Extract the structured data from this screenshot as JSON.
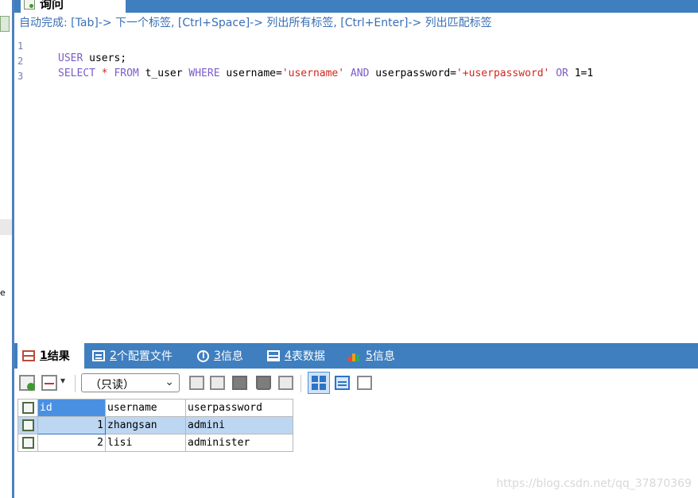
{
  "left_panel": {
    "partial_char": "e"
  },
  "query_tab": {
    "label": "询问",
    "add_label": "+"
  },
  "editor": {
    "hint": "自动完成: [Tab]-> 下一个标签, [Ctrl+Space]-> 列出所有标签, [Ctrl+Enter]-> 列出匹配标签",
    "lines": [
      {
        "no": "1",
        "kw1": "USER",
        "rest": " users;"
      },
      {
        "no": "2",
        "kw1": "SELECT",
        "star": " * ",
        "kw2": "FROM",
        "t1": " t_user ",
        "kw3": "WHERE",
        "t2": " username=",
        "s1": "'username'",
        "t3": " ",
        "kw4": "AND",
        "t4": " userpassword=",
        "s2": "'+userpassword'",
        "t5": " ",
        "kw5": "OR",
        "t6": " 1=1"
      },
      {
        "no": "3"
      }
    ]
  },
  "results_tabs": [
    {
      "num": "1",
      "label": " 结果"
    },
    {
      "num": "2",
      "label": " 个配置文件"
    },
    {
      "num": "3",
      "label": " 信息"
    },
    {
      "num": "4",
      "label": " 表数据"
    },
    {
      "num": "5",
      "label": " 信息"
    }
  ],
  "toolbar": {
    "mode_value": "（只读）",
    "dropdown_arrow": "▾",
    "chevron": "⌄"
  },
  "grid": {
    "columns": [
      "id",
      "username",
      "userpassword"
    ],
    "rows": [
      {
        "id": "1",
        "username": "zhangsan",
        "userpassword": "admini"
      },
      {
        "id": "2",
        "username": "lisi",
        "userpassword": "administer"
      }
    ]
  },
  "watermark": "https://blog.csdn.net/qq_37870369",
  "colors": {
    "accent": "#3f7fbf",
    "keyword": "#7b5cc9",
    "string": "#d0261f",
    "selection": "#bdd7f3"
  }
}
